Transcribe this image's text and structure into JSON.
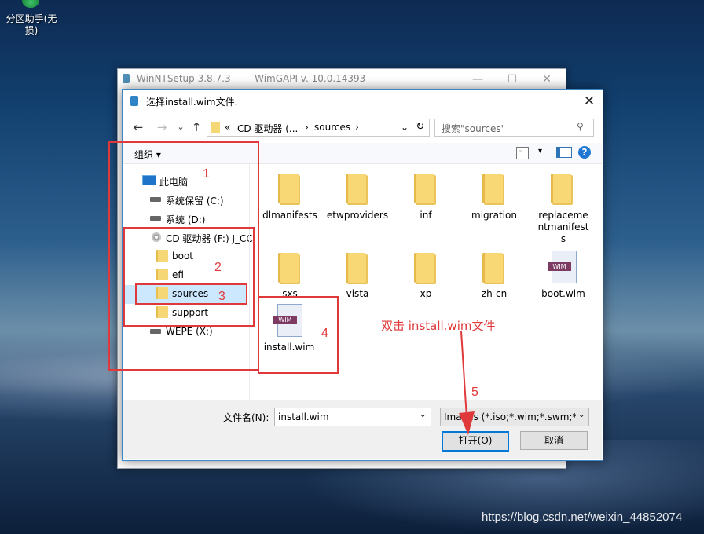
{
  "desktop": {
    "icon_label": "分区助手(无损)"
  },
  "back_window": {
    "title": "WinNTSetup 3.8.7.3        WimGAPI v. 10.0.14393",
    "minimize": "—",
    "maximize": "☐",
    "close": "✕"
  },
  "dialog": {
    "title": "选择install.wim文件.",
    "close": "✕",
    "nav": {
      "back": "←",
      "forward": "→",
      "recent": "⌄",
      "up": "↑"
    },
    "address": {
      "prefix": "«",
      "crumb1": "CD 驱动器 (...",
      "sep1": "›",
      "crumb2": "sources",
      "sep2": "›",
      "dropdown": "⌄",
      "refresh": "↻"
    },
    "search_placeholder": "搜索\"sources\"",
    "toolbar": {
      "organize": "组织 ▾",
      "help": "?"
    },
    "tree": [
      {
        "label": "此电脑"
      },
      {
        "label": "系统保留 (C:)"
      },
      {
        "label": "系统 (D:)"
      },
      {
        "label": "CD 驱动器 (F:) J_CC"
      },
      {
        "label": "boot"
      },
      {
        "label": "efi"
      },
      {
        "label": "sources"
      },
      {
        "label": "support"
      },
      {
        "label": "WEPE (X:)"
      }
    ],
    "files": [
      {
        "name": "dlmanifests"
      },
      {
        "name": "etwproviders"
      },
      {
        "name": "inf"
      },
      {
        "name": "migration"
      },
      {
        "name": "replacementmanifests"
      },
      {
        "name": "sxs"
      },
      {
        "name": "vista"
      },
      {
        "name": "xp"
      },
      {
        "name": "zh-cn"
      },
      {
        "name": "boot.wim"
      },
      {
        "name": "install.wim"
      }
    ],
    "wim_badge": "WIM",
    "filename_label": "文件名(N):",
    "filename_value": "install.wim",
    "filter_value": "Images (*.iso;*.wim;*.swm;*.e",
    "open_button": "打开(O)",
    "cancel_button": "取消"
  },
  "annotations": {
    "n1": "1",
    "n2": "2",
    "n3": "3",
    "n4": "4",
    "n5": "5",
    "instruction": "双击 install.wim文件",
    "color": "#e0393b"
  },
  "watermark": "https://blog.csdn.net/weixin_44852074"
}
